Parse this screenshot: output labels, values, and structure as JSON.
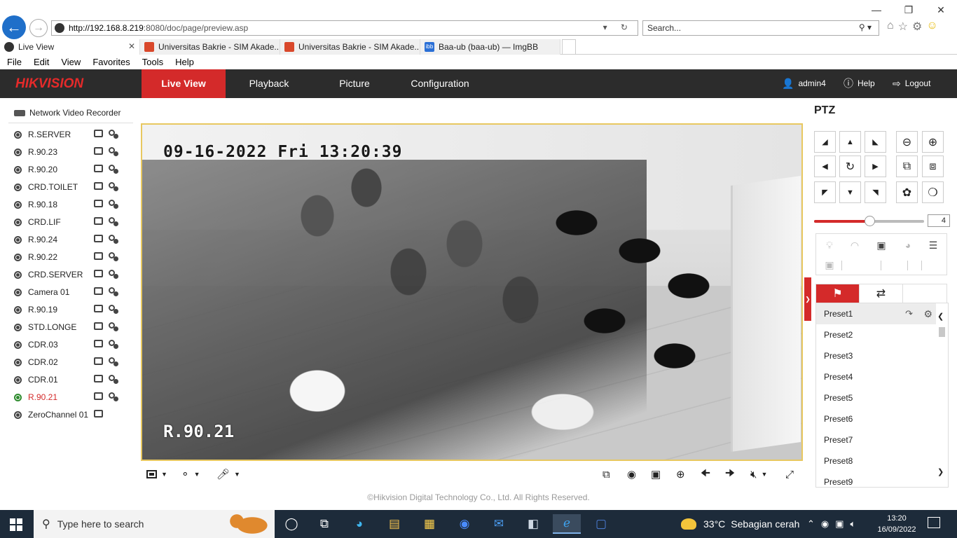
{
  "browser": {
    "url_host": "http://192.168.8.219",
    "url_path": ":8080/doc/page/preview.asp",
    "search_placeholder": "Search...",
    "tabs": [
      {
        "label": "Live View",
        "icon": "camera-favicon-icon"
      },
      {
        "label": "Universitas Bakrie - SIM Akade...",
        "icon": "ub-favicon-icon"
      },
      {
        "label": "Universitas Bakrie - SIM Akade...",
        "icon": "ub-favicon-icon"
      },
      {
        "label": "Baa-ub (baa-ub) — ImgBB",
        "icon": "ibb-favicon-icon"
      }
    ],
    "ibb_badge": "ibb",
    "menu": [
      "File",
      "Edit",
      "View",
      "Favorites",
      "Tools",
      "Help"
    ]
  },
  "header": {
    "logo": "HIKVISION",
    "nav": [
      "Live View",
      "Playback",
      "Picture",
      "Configuration"
    ],
    "active_nav": "Live View",
    "user": "admin4",
    "help": "Help",
    "logout": "Logout"
  },
  "tree": {
    "title": "Network Video Recorder",
    "cameras": [
      {
        "name": "R.SERVER",
        "live": false
      },
      {
        "name": "R.90.23",
        "live": false
      },
      {
        "name": "R.90.20",
        "live": false
      },
      {
        "name": "CRD.TOILET",
        "live": false
      },
      {
        "name": "R.90.18",
        "live": false
      },
      {
        "name": "CRD.LIF",
        "live": false
      },
      {
        "name": "R.90.24",
        "live": false
      },
      {
        "name": "R.90.22",
        "live": false
      },
      {
        "name": "CRD.SERVER",
        "live": false
      },
      {
        "name": "Camera 01",
        "live": false
      },
      {
        "name": "R.90.19",
        "live": false
      },
      {
        "name": "STD.LONGE",
        "live": false
      },
      {
        "name": "CDR.03",
        "live": false
      },
      {
        "name": "CDR.02",
        "live": false
      },
      {
        "name": "CDR.01",
        "live": false
      },
      {
        "name": "R.90.21",
        "live": true
      },
      {
        "name": "ZeroChannel 01",
        "live": false
      }
    ]
  },
  "video": {
    "osd_datetime": "09-16-2022 Fri 13:20:39",
    "osd_channel": "R.90.21"
  },
  "footer": {
    "copyright": "©Hikvision Digital Technology Co., Ltd. All Rights Reserved."
  },
  "ptz": {
    "title": "PTZ",
    "speed": "4",
    "speed_level": 0.5,
    "presets": [
      "Preset1",
      "Preset2",
      "Preset3",
      "Preset4",
      "Preset5",
      "Preset6",
      "Preset7",
      "Preset8",
      "Preset9"
    ],
    "selected_preset": "Preset1"
  },
  "taskbar": {
    "search_placeholder": "Type here to search",
    "temperature": "33°C",
    "weather": "Sebagian cerah",
    "time": "13:20",
    "date": "16/09/2022"
  },
  "colors": {
    "accent": "#d42a2a",
    "header_bg": "#2c2c2c",
    "video_border": "#e8c860",
    "taskbar_bg": "#1d2b3a"
  }
}
